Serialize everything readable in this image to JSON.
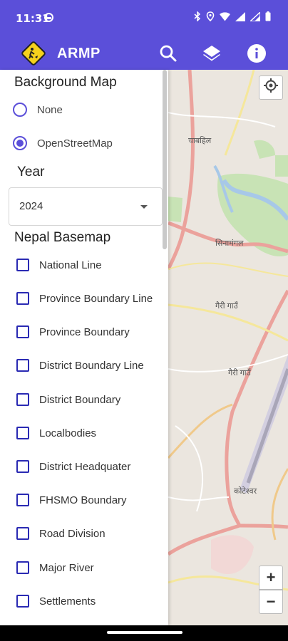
{
  "status_bar": {
    "time": "11:31"
  },
  "app_bar": {
    "title": "ARMP",
    "color": "#5b4fd9"
  },
  "drawer": {
    "background_map": {
      "title": "Background Map",
      "options": [
        {
          "label": "None",
          "selected": false
        },
        {
          "label": "OpenStreetMap",
          "selected": true
        }
      ]
    },
    "year": {
      "title": "Year",
      "selected": "2024"
    },
    "nepal_basemap": {
      "title": "Nepal Basemap",
      "layers": [
        {
          "label": "National Line",
          "checked": false
        },
        {
          "label": "Province Boundary Line",
          "checked": false
        },
        {
          "label": "Province Boundary",
          "checked": false
        },
        {
          "label": "District Boundary Line",
          "checked": false
        },
        {
          "label": "District Boundary",
          "checked": false
        },
        {
          "label": "Localbodies",
          "checked": false
        },
        {
          "label": "District Headquater",
          "checked": false
        },
        {
          "label": "FHSMO Boundary",
          "checked": false
        },
        {
          "label": "Road Division",
          "checked": false
        },
        {
          "label": "Major River",
          "checked": false
        },
        {
          "label": "Settlements",
          "checked": false
        }
      ]
    }
  },
  "map": {
    "zoom_in": "+",
    "zoom_out": "−",
    "labels": [
      "चाबहिल",
      "सिनामंगल",
      "गैरी गाउँ",
      "कोटेश्वर"
    ]
  },
  "icons": {
    "search": "search-icon",
    "layers": "layers-icon",
    "info": "info-icon",
    "locate": "locate-icon"
  }
}
